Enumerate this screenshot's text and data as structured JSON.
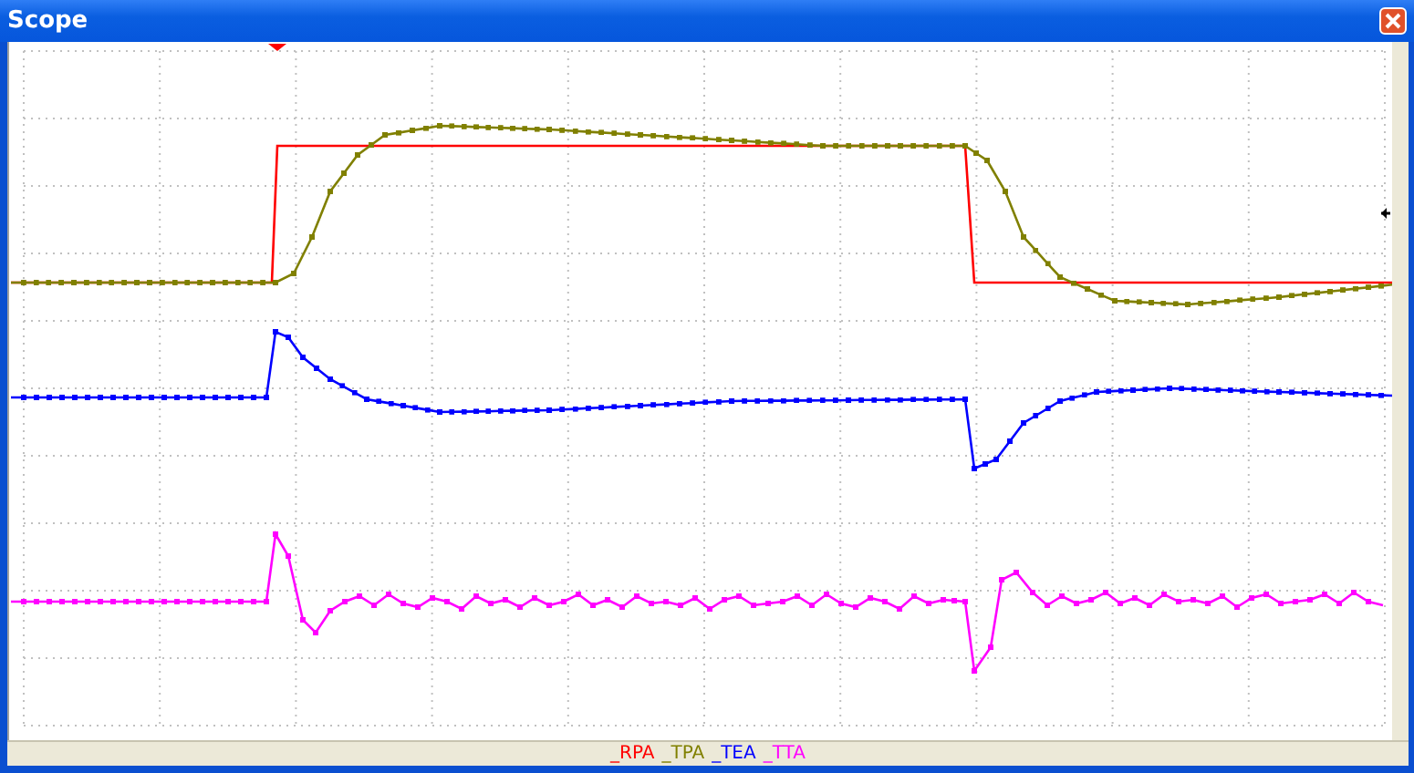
{
  "window": {
    "title": "Scope"
  },
  "legend": [
    {
      "label": "_RPA",
      "color": "#ff0000"
    },
    {
      "label": "_TPA",
      "color": "#808000"
    },
    {
      "label": "_TEA",
      "color": "#0000ff"
    },
    {
      "label": "_TTA",
      "color": "#ff00ff"
    }
  ]
}
